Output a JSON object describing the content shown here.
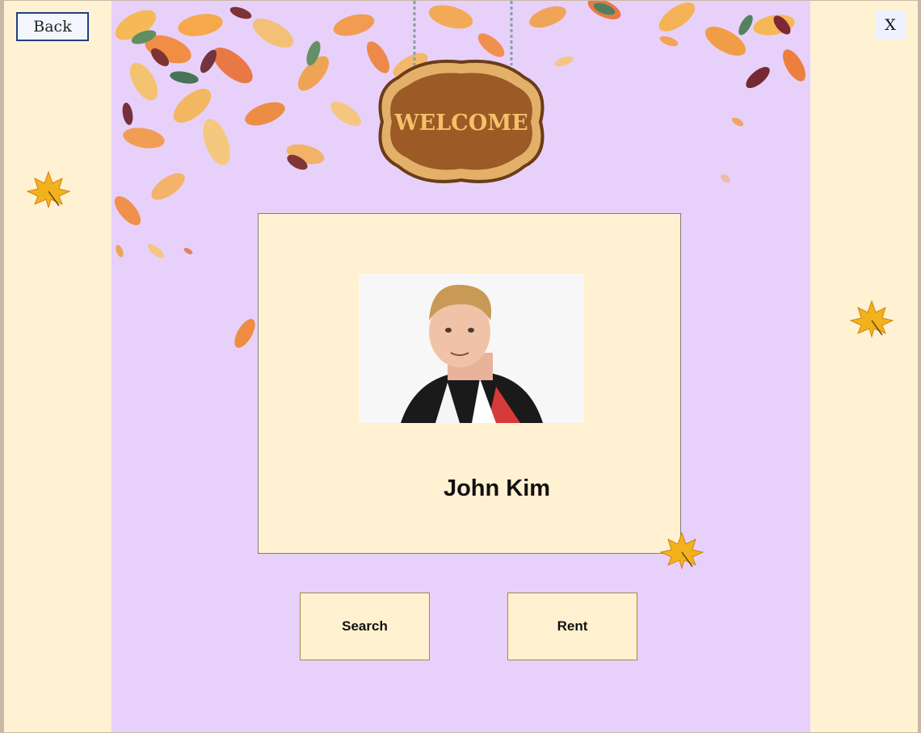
{
  "window": {
    "back_label": "Back",
    "close_label": "X"
  },
  "sign": {
    "text": "WELCOME"
  },
  "profile": {
    "name": "John Kim",
    "photo_icon": "person-portrait"
  },
  "actions": {
    "search_label": "Search",
    "rent_label": "Rent"
  },
  "colors": {
    "side_panel": "#fff2d3",
    "center_panel": "#e7d1fb",
    "card": "#fff1d1",
    "back_border": "#1f3f86",
    "button_border": "#a6874b"
  },
  "decorations": [
    "autumn-leaves",
    "maple-leaf-icon",
    "wooden-sign"
  ]
}
